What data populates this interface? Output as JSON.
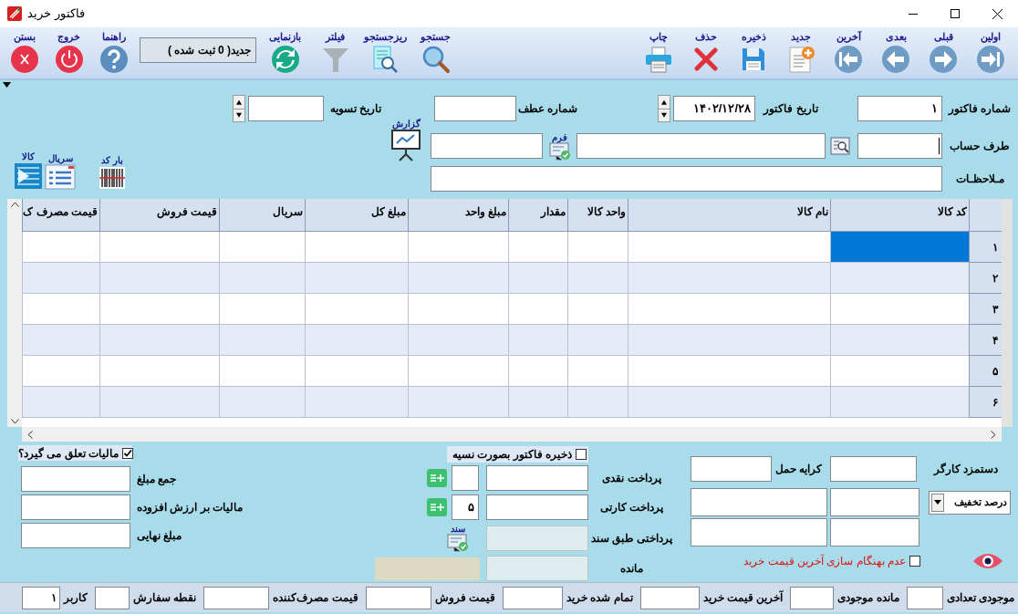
{
  "window": {
    "title": "فاکتور خرید"
  },
  "toolbar": {
    "nav_buttons": [
      {
        "label": "اولین",
        "kind": "first"
      },
      {
        "label": "قبلی",
        "kind": "previous"
      },
      {
        "label": "بعدی",
        "kind": "next"
      },
      {
        "label": "آخرین",
        "kind": "last"
      },
      {
        "label": "جدید",
        "kind": "new"
      },
      {
        "label": "ذخیره",
        "kind": "save"
      },
      {
        "label": "حذف",
        "kind": "delete"
      },
      {
        "label": "چاپ",
        "kind": "print"
      }
    ],
    "search_buttons": [
      {
        "label": "جستجو",
        "kind": "search"
      },
      {
        "label": "ریزجستجو",
        "kind": "detail_search"
      },
      {
        "label": "فیلتر",
        "kind": "filter"
      },
      {
        "label": "بازنمایی",
        "kind": "refresh"
      }
    ],
    "record_status": "جدید( 0 ثبت شده )",
    "exit_buttons": [
      {
        "label": "راهنما",
        "kind": "help"
      },
      {
        "label": "خروج",
        "kind": "exit"
      },
      {
        "label": "بستن",
        "kind": "close"
      }
    ]
  },
  "header": {
    "invoice_number": {
      "label": "شماره فاکتور",
      "value": "۱"
    },
    "invoice_date": {
      "label": "تاریخ  فاکتور",
      "value": "۱۴۰۲/۱۲/۲۸"
    },
    "reference_number": {
      "label": "شماره عطف"
    },
    "settlement_date": {
      "label": "تاریخ تسویه"
    },
    "account": {
      "label": "طرف حساب"
    },
    "form_button": "فرم",
    "report_button": "گزارش",
    "notes": {
      "label": "مـلاحظـات"
    }
  },
  "item_buttons": [
    {
      "label": "بار کد",
      "kind": "barcode"
    },
    {
      "label": "سریال",
      "kind": "serial"
    },
    {
      "label": "کالا",
      "kind": "goods"
    }
  ],
  "table": {
    "columns": [
      "کد کالا",
      "نام کالا",
      "واحد کالا",
      "مقدار",
      "مبلغ واحد",
      "مبلغ کل",
      "سریال",
      "قیمت فروش",
      "قیمت مصرف ک"
    ],
    "rows": [
      {
        "number": "۱",
        "selected": true
      },
      {
        "number": "۲",
        "selected": false
      },
      {
        "number": "۳",
        "selected": false
      },
      {
        "number": "۴",
        "selected": false
      },
      {
        "number": "۵",
        "selected": false
      },
      {
        "number": "۶",
        "selected": false
      }
    ]
  },
  "costs": {
    "labor": "دستمزد کارگر",
    "freight": "کرایه حمل",
    "discount": "درصد تخفیف",
    "no_update": {
      "label": "عدم بهنگام سازی آخرین قیمت خرید",
      "checked": false
    }
  },
  "payment": {
    "credit_save": {
      "label": "ذخیره فاکتور بصورت نسیه",
      "checked": false
    },
    "rows": [
      {
        "label": "پرداخت نقدی",
        "kind": "cash"
      },
      {
        "label": "پرداخت کارتی",
        "kind": "card",
        "count": "۵"
      },
      {
        "label": "پرداختی طبق سند",
        "kind": "document",
        "button": "سند"
      },
      {
        "label": "مانده",
        "kind": "balance"
      }
    ]
  },
  "totals": {
    "tax": {
      "label": "مالیات تعلق می گیرد؟",
      "checked": true
    },
    "rows": [
      {
        "label": "جمع مبلغ"
      },
      {
        "label": "مالیات بر ارزش افزوده"
      },
      {
        "label": "مبلغ نهایی"
      }
    ]
  },
  "status_bar": [
    {
      "label": "موجودی تعدادی"
    },
    {
      "label": "مانده موجودی"
    },
    {
      "label": "آخرین قیمت خرید"
    },
    {
      "label": "تمام شده خرید"
    },
    {
      "label": "قیمت فروش"
    },
    {
      "label": "قیمت مصرف‌کننده"
    },
    {
      "label": "نقطه سفارش"
    },
    {
      "label": "کاربر",
      "value": "۱"
    }
  ]
}
